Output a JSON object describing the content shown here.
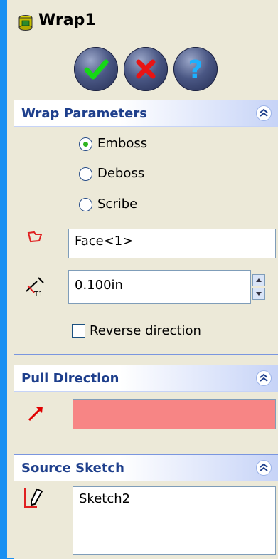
{
  "window": {
    "title": "Wrap1"
  },
  "actions": {
    "ok_icon": "green-checkmark-icon",
    "cancel_icon": "red-x-icon",
    "help_icon": "question-mark-icon"
  },
  "wrap_parameters": {
    "title": "Wrap Parameters",
    "options": [
      {
        "label": "Emboss",
        "selected": true
      },
      {
        "label": "Deboss",
        "selected": false
      },
      {
        "label": "Scribe",
        "selected": false
      }
    ],
    "face_value": "Face<1>",
    "thickness_value": "0.100in",
    "reverse_direction_label": "Reverse direction",
    "reverse_direction_checked": false
  },
  "pull_direction": {
    "title": "Pull Direction",
    "value": "",
    "field_color": "#f78585"
  },
  "source_sketch": {
    "title": "Source Sketch",
    "value": "Sketch2"
  },
  "colors": {
    "frame": "#1890f2",
    "panel_title": "#1e3f8c",
    "radio_dot": "#2fb41f"
  }
}
